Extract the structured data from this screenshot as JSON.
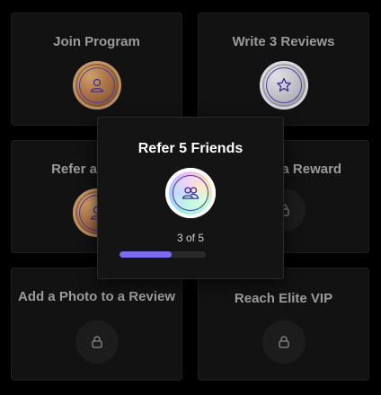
{
  "cards": [
    {
      "title": "Join Program",
      "badge": "bronze",
      "icon": "user-icon"
    },
    {
      "title": "Write 3 Reviews",
      "badge": "silver",
      "icon": "star-icon"
    },
    {
      "title": "Refer a Friend",
      "badge": "bronze",
      "icon": "user-icon"
    },
    {
      "title": "Redeem a Reward",
      "badge": "locked",
      "icon": "lock-icon"
    },
    {
      "title": "Add a Photo to a Review",
      "badge": "locked",
      "icon": "lock-icon"
    },
    {
      "title": "Reach Elite VIP",
      "badge": "locked",
      "icon": "lock-icon"
    }
  ],
  "modal": {
    "title": "Refer 5 Friends",
    "icon": "users-icon",
    "progress_text": "3 of 5",
    "progress_fraction": 0.6
  },
  "colors": {
    "accent": "#7c6cf0",
    "card_bg": "#121212",
    "page_bg": "#000000"
  }
}
